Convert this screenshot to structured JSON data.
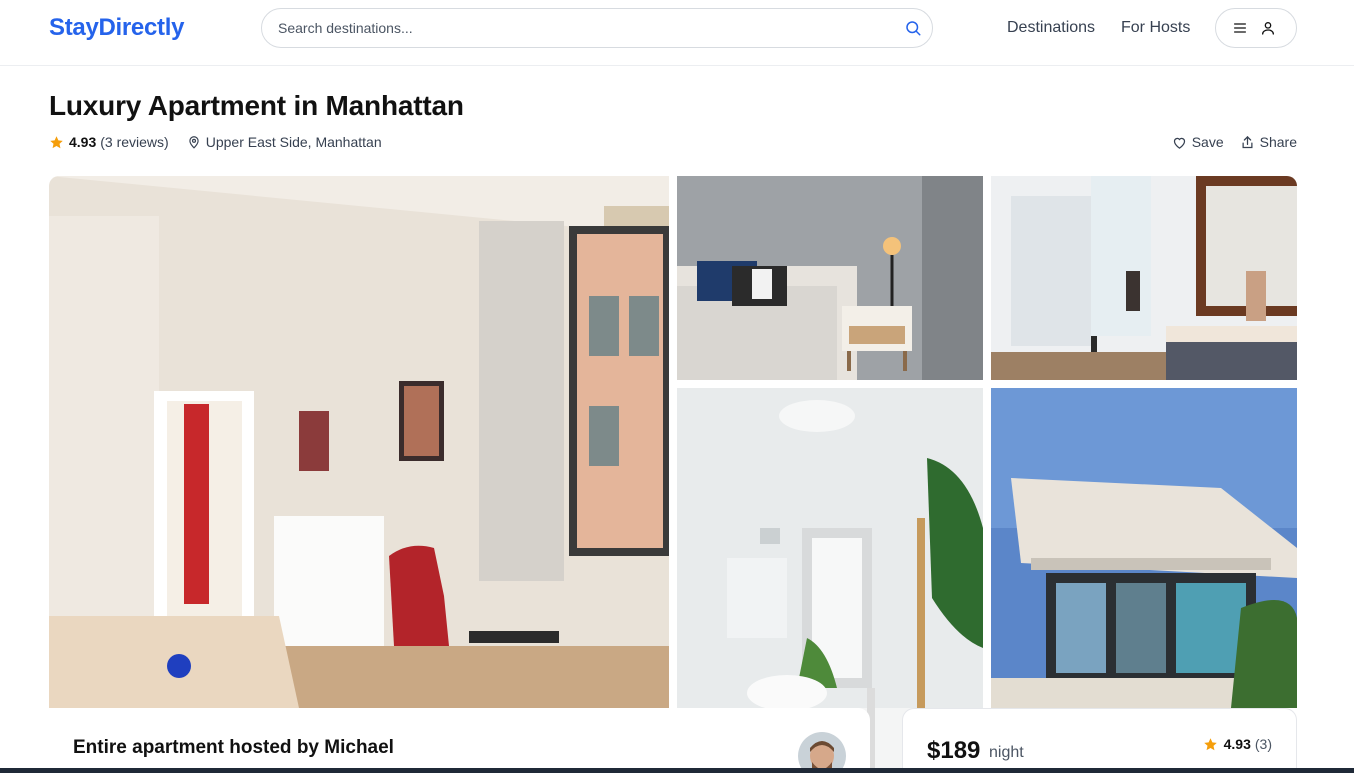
{
  "brand": {
    "name": "StayDirectly",
    "accent": "#2563eb"
  },
  "search": {
    "placeholder": "Search destinations..."
  },
  "nav": {
    "destinations": "Destinations",
    "hosts": "For Hosts"
  },
  "listing": {
    "title": "Luxury Apartment in Manhattan",
    "rating": "4.93",
    "reviews": "(3 reviews)",
    "location": "Upper East Side, Manhattan"
  },
  "actions": {
    "save": "Save",
    "share": "Share"
  },
  "photos": [
    "living-room",
    "bedroom",
    "bathroom",
    "bright-bathroom",
    "modern-house"
  ],
  "host": {
    "title": "Entire apartment hosted by Michael"
  },
  "booking": {
    "price": "$189",
    "per": "night",
    "rating": "4.93",
    "count": "(3)"
  },
  "icons": [
    "search-icon",
    "menu-icon",
    "user-icon",
    "star-icon",
    "map-pin-icon",
    "heart-icon",
    "share-icon"
  ],
  "colors": {
    "star": "#f59e0b",
    "text": "#111827",
    "muted": "#4b5563"
  }
}
